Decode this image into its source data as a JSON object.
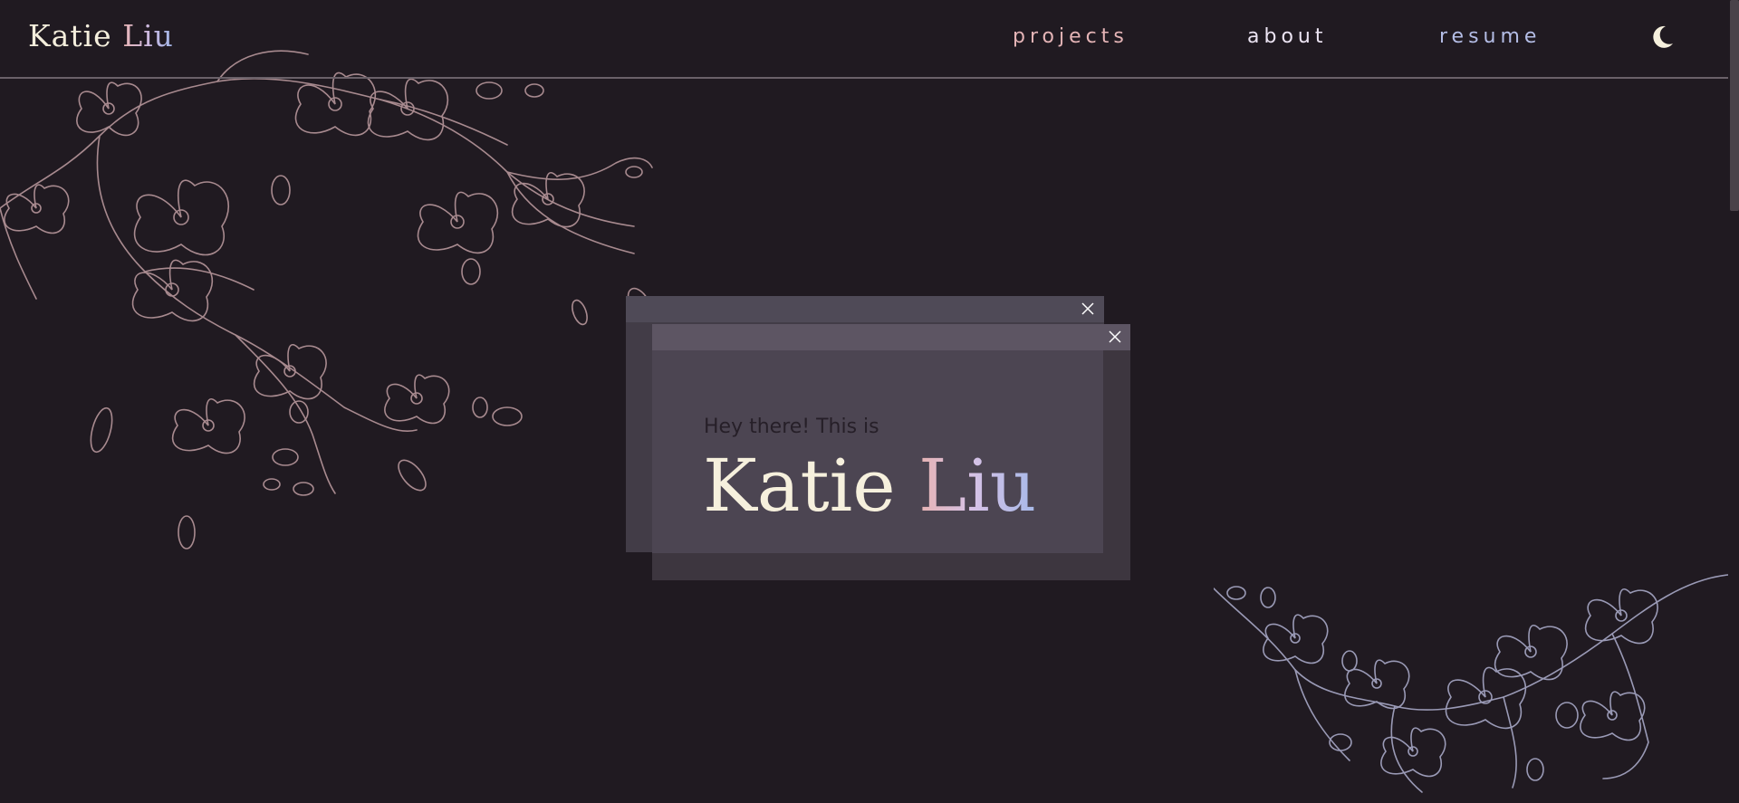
{
  "header": {
    "logo_first": "Katie",
    "logo_last": "Liu",
    "nav": [
      {
        "label": "projects",
        "color": "#e4b4b6"
      },
      {
        "label": "about",
        "color": "#ece4f3"
      },
      {
        "label": "resume",
        "color": "#b4bde6"
      }
    ],
    "theme_icon": "moon-icon"
  },
  "hero": {
    "greeting": "Hey there! This is",
    "name_first": "Katie",
    "name_last": "Liu",
    "close_icon": "close-icon"
  },
  "colors": {
    "background": "#201a21",
    "accent_pink": "#e8b4b4",
    "accent_lavender": "#c9b8e2",
    "accent_blue": "#9fb4e6",
    "cream": "#f4eedc",
    "floral_pink": "#a88a8f",
    "floral_blue": "#9a9ab6"
  }
}
